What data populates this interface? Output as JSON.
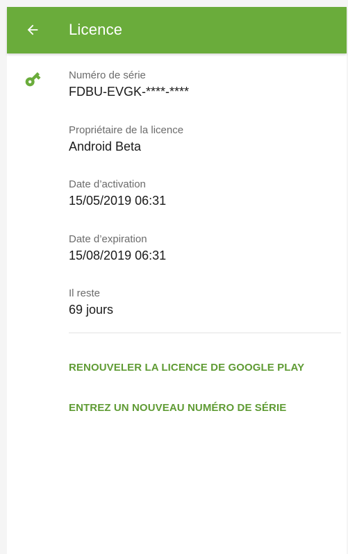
{
  "appbar": {
    "title": "Licence",
    "back_icon": "arrow-left-icon",
    "color": "#6aac3b"
  },
  "license": {
    "icon": "key-icon",
    "accent": "#6aac3b",
    "fields": [
      {
        "label": "Numéro de série",
        "value": "FDBU-EVGK-****-****"
      },
      {
        "label": "Propriétaire de la licence",
        "value": "Android Beta"
      },
      {
        "label": "Date d’activation",
        "value": "15/05/2019 06:31"
      },
      {
        "label": "Date d’expiration",
        "value": "15/08/2019 06:31"
      },
      {
        "label": "Il reste",
        "value": "69 jours"
      }
    ]
  },
  "actions": {
    "renew": "RENOUVELER LA LICENCE DE GOOGLE PLAY",
    "enter_serial": "ENTREZ UN NOUVEAU NUMÉRO DE SÉRIE",
    "color": "#5f9b34"
  }
}
